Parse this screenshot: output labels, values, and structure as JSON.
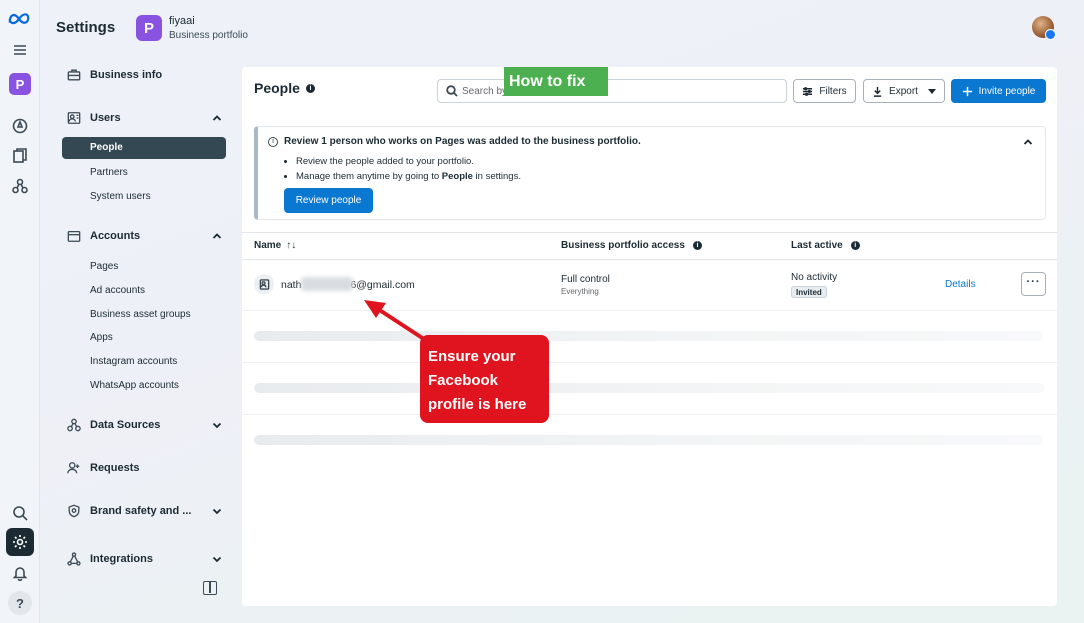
{
  "header": {
    "title": "Settings",
    "portfolio_initial": "P",
    "portfolio_name": "fiyaai",
    "portfolio_subtitle": "Business portfolio"
  },
  "rail": {
    "badge": "P",
    "help": "?"
  },
  "sidebar": {
    "business_info": "Business info",
    "users": "Users",
    "users_items": [
      "People",
      "Partners",
      "System users"
    ],
    "accounts": "Accounts",
    "accounts_items": [
      "Pages",
      "Ad accounts",
      "Business asset groups",
      "Apps",
      "Instagram accounts",
      "WhatsApp accounts"
    ],
    "data_sources": "Data Sources",
    "requests": "Requests",
    "brand_safety": "Brand safety and ...",
    "integrations": "Integrations"
  },
  "main": {
    "title": "People",
    "search_placeholder": "Search by",
    "filters_label": "Filters",
    "export_label": "Export",
    "invite_label": "Invite people",
    "notice": {
      "title": "Review 1 person who works on Pages was added to the business portfolio.",
      "bullet1": "Review the people added to your portfolio.",
      "bullet2_prefix": "Manage them anytime by going to ",
      "bullet2_bold": "People",
      "bullet2_suffix": " in settings.",
      "button": "Review people"
    },
    "table": {
      "headers": {
        "name": "Name",
        "sort_icon": "↑↓",
        "access": "Business portfolio access",
        "last_active": "Last active"
      },
      "row": {
        "email_prefix": "nath",
        "email_suffix": "6@gmail.com",
        "access": "Full control",
        "access_sub": "Everything",
        "last_active": "No activity",
        "status_badge": "Invited",
        "details": "Details",
        "more": "···"
      }
    }
  },
  "overlay": {
    "banner": "How to fix",
    "callout_lines": [
      "Ensure your",
      "Facebook",
      "profile is here"
    ],
    "colors": {
      "banner": "#4caf50",
      "callout": "#e0141e"
    }
  },
  "colors": {
    "accent": "#0a78d1",
    "nav_active": "#344854",
    "portfolio_badge": "#8a52e0"
  }
}
